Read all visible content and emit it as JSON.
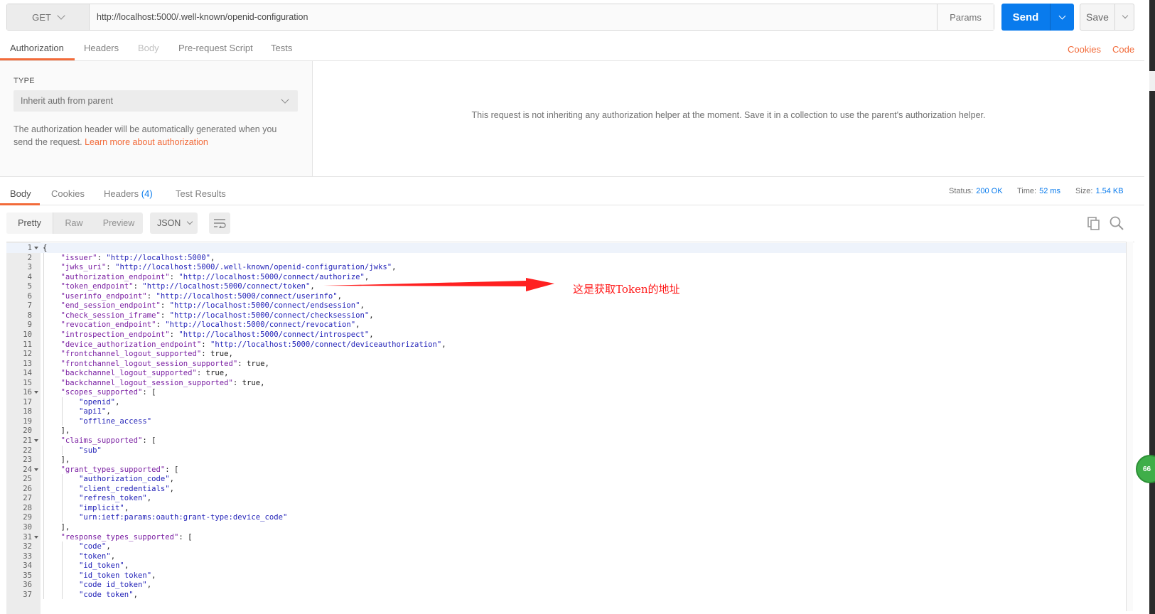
{
  "request": {
    "method": "GET",
    "url": "http://localhost:5000/.well-known/openid-configuration",
    "params_label": "Params",
    "send_label": "Send",
    "save_label": "Save"
  },
  "request_tabs": {
    "items": [
      "Authorization",
      "Headers",
      "Body",
      "Pre-request Script",
      "Tests"
    ],
    "cookies": "Cookies",
    "code": "Code"
  },
  "auth": {
    "type_label": "TYPE",
    "type_value": "Inherit auth from parent",
    "description": "The authorization header will be automatically generated when you send the request.",
    "learn_more": "Learn more about authorization",
    "message": "This request is not inheriting any authorization helper at the moment. Save it in a collection to use the parent's authorization helper."
  },
  "response_tabs": {
    "body": "Body",
    "cookies": "Cookies",
    "headers": "Headers",
    "headers_count": "(4)",
    "test_results": "Test Results"
  },
  "status": {
    "status_label": "Status:",
    "status_value": "200 OK",
    "time_label": "Time:",
    "time_value": "52 ms",
    "size_label": "Size:",
    "size_value": "1.54 KB"
  },
  "view_modes": [
    "Pretty",
    "Raw",
    "Preview"
  ],
  "format": "JSON",
  "code_lines": [
    "{",
    "    \"issuer\": \"http://localhost:5000\",",
    "    \"jwks_uri\": \"http://localhost:5000/.well-known/openid-configuration/jwks\",",
    "    \"authorization_endpoint\": \"http://localhost:5000/connect/authorize\",",
    "    \"token_endpoint\": \"http://localhost:5000/connect/token\",",
    "    \"userinfo_endpoint\": \"http://localhost:5000/connect/userinfo\",",
    "    \"end_session_endpoint\": \"http://localhost:5000/connect/endsession\",",
    "    \"check_session_iframe\": \"http://localhost:5000/connect/checksession\",",
    "    \"revocation_endpoint\": \"http://localhost:5000/connect/revocation\",",
    "    \"introspection_endpoint\": \"http://localhost:5000/connect/introspect\",",
    "    \"device_authorization_endpoint\": \"http://localhost:5000/connect/deviceauthorization\",",
    "    \"frontchannel_logout_supported\": true,",
    "    \"frontchannel_logout_session_supported\": true,",
    "    \"backchannel_logout_supported\": true,",
    "    \"backchannel_logout_session_supported\": true,",
    "    \"scopes_supported\": [",
    "        \"openid\",",
    "        \"api1\",",
    "        \"offline_access\"",
    "    ],",
    "    \"claims_supported\": [",
    "        \"sub\"",
    "    ],",
    "    \"grant_types_supported\": [",
    "        \"authorization_code\",",
    "        \"client_credentials\",",
    "        \"refresh_token\",",
    "        \"implicit\",",
    "        \"urn:ietf:params:oauth:grant-type:device_code\"",
    "    ],",
    "    \"response_types_supported\": [",
    "        \"code\",",
    "        \"token\",",
    "        \"id_token\",",
    "        \"id_token token\",",
    "        \"code id_token\",",
    "        \"code token\","
  ],
  "fold_lines": [
    1,
    16,
    21,
    24,
    31
  ],
  "annotation": "这是获取Token的地址",
  "badge": "66",
  "colors": {
    "accent": "#f26b3a",
    "primary": "#097bed",
    "annotation": "#ff1a1a"
  }
}
